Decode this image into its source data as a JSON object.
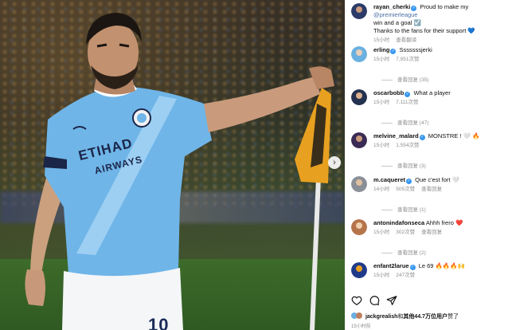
{
  "post": {
    "jersey_number": "10",
    "sponsor_line1": "ETIHAD",
    "sponsor_line2": "AIRWAYS"
  },
  "comments": [
    {
      "username": "rayan_cherki",
      "text_before": "Proud to make my ",
      "mention": "@premierleague",
      "text_after": " win and a goal",
      "emoji": "☑️",
      "line2": "Thanks to the fans for their support",
      "line2_emoji": "💙",
      "time": "15小时",
      "action": "查看翻译",
      "avatar_color": "#2b3a68"
    },
    {
      "username": "erling",
      "text": "Sssssssjerki",
      "time": "15小时",
      "likes": "7,951次赞",
      "replies": "查看回复 (35)",
      "avatar_color": "#6ab0e0"
    },
    {
      "username": "oscarbobb",
      "text": "What a player",
      "time": "15小时",
      "likes": "7,111次赞",
      "replies": "查看回复 (47)",
      "avatar_color": "#24324f"
    },
    {
      "username": "melvine_malard",
      "text": "MONSTRE !",
      "emojis": "🤍 🔥",
      "time": "15小时",
      "likes": "1,554次赞",
      "replies": "查看回复 (3)",
      "avatar_color": "#3a2a55"
    },
    {
      "username": "m.caqueret",
      "text": "Que c'est fort",
      "emojis": "🤍",
      "time": "14小时",
      "likes": "505次赞",
      "reply": "查看回复",
      "replies": "查看回复 (1)",
      "avatar_color": "#8a8f98"
    },
    {
      "username": "antonindafonseca",
      "text": "Ahhh frero",
      "emojis": "❤️",
      "time": "15小时",
      "likes": "302次赞",
      "reply": "查看回复",
      "replies": "查看回复 (2)",
      "avatar_color": "#b5744a"
    },
    {
      "username": "enfant2larue",
      "text": "Le 69",
      "emojis": "🔥🔥🔥🙌",
      "time": "15小时",
      "likes": "247次赞",
      "avatar_color": "#1f3a8a"
    }
  ],
  "footer": {
    "liked_by_user": "jackgrealish",
    "liked_by_mid": "和",
    "liked_by_count": "其他44.7万位用户",
    "liked_by_suffix": "赞了",
    "time": "15小时前"
  }
}
